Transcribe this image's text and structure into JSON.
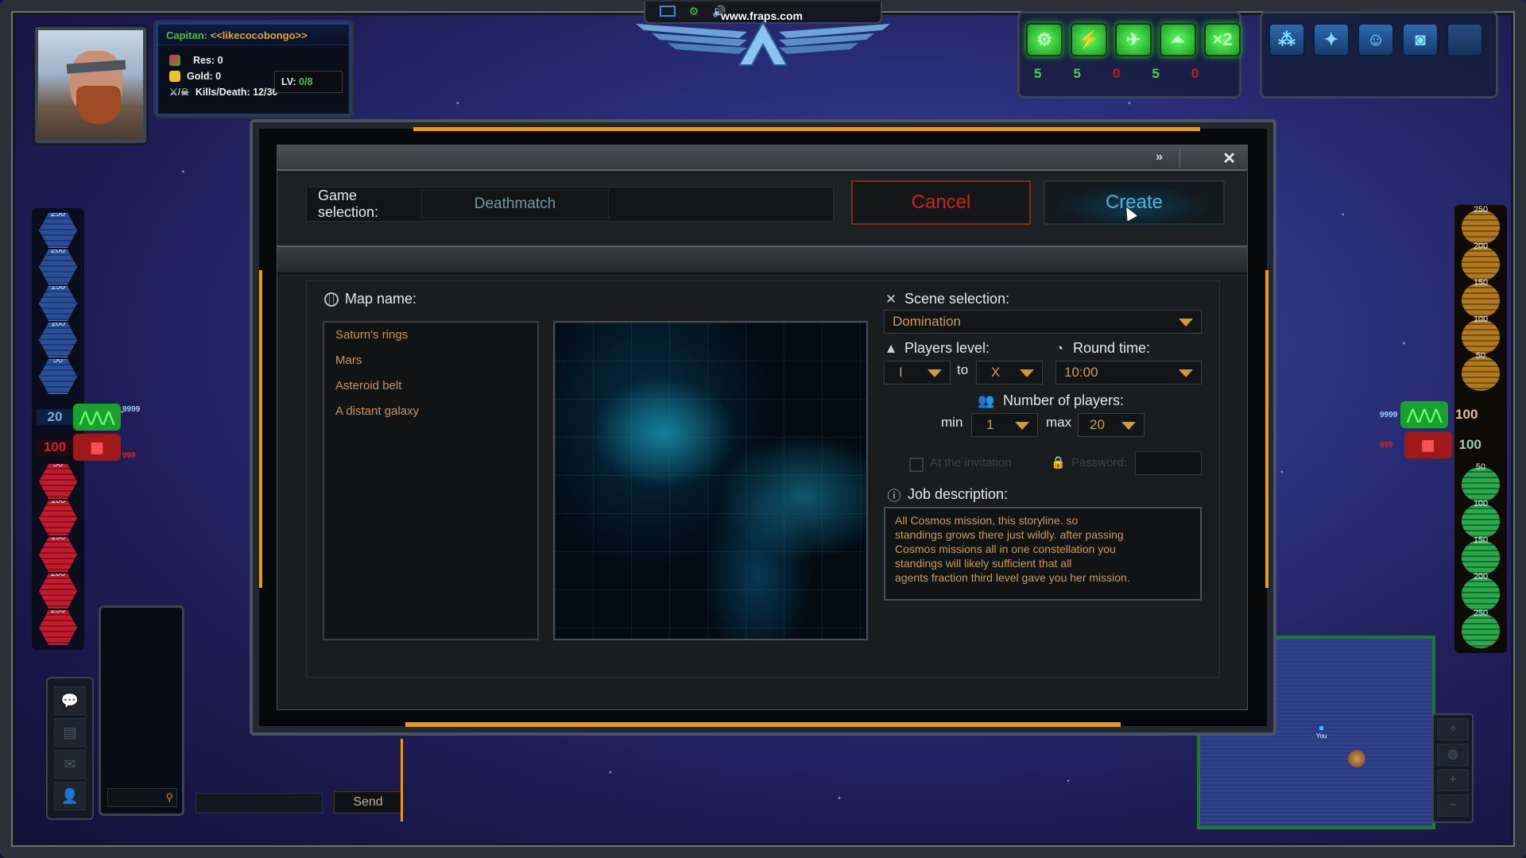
{
  "hud": {
    "player": {
      "title_prefix": "Capitan:",
      "name": "<<likecocobongo>>",
      "res_label": "Res: 0",
      "gold_label": "Gold: 0",
      "kd_label": "Kills/Death: 12/30",
      "lv_label": "LV:",
      "lv_value": "0/8"
    },
    "top_bar": {
      "watermark": "www.fraps.com",
      "icons": [
        "screen-icon",
        "gear-icon",
        "speaker-icon"
      ]
    },
    "ability_green": {
      "buttons": [
        {
          "icon": "shield-gear-icon",
          "glyph": "⚙",
          "count": "5",
          "count_color": "green"
        },
        {
          "icon": "shield-bolt-icon",
          "glyph": "⚡",
          "count": "5",
          "count_color": "green"
        },
        {
          "icon": "rocket-icon",
          "glyph": "✈",
          "count": "0",
          "count_color": "red"
        },
        {
          "icon": "rank-chevron-icon",
          "glyph": "⏶",
          "count": "5",
          "count_color": "green"
        },
        {
          "icon": "x2-icon",
          "glyph": "×2",
          "count": "0",
          "count_color": "red"
        }
      ]
    },
    "ability_blue": {
      "buttons": [
        {
          "icon": "formation-icon",
          "glyph": "⁂"
        },
        {
          "icon": "target-ship-icon",
          "glyph": "✦"
        },
        {
          "icon": "smiley-icon",
          "glyph": "☺"
        },
        {
          "icon": "goggles-icon",
          "glyph": "◙"
        },
        {
          "icon": "empty-slot",
          "glyph": ""
        }
      ]
    },
    "left_gauge": {
      "top_ticks": [
        "250",
        "200",
        "150",
        "100",
        "50"
      ],
      "bottom_ticks": [
        "50",
        "100",
        "150",
        "200",
        "250"
      ],
      "upper_value": "20",
      "lower_value": "100",
      "upper_small": "9999",
      "lower_small": "999"
    },
    "right_gauge": {
      "top_ticks": [
        "250",
        "200",
        "150",
        "100",
        "50"
      ],
      "bottom_ticks": [
        "50",
        "100",
        "150",
        "200",
        "250"
      ],
      "upper_value": "100",
      "lower_value": "100",
      "upper_small": "9999",
      "lower_small": "999"
    },
    "chat": {
      "send_label": "Send",
      "side_buttons": [
        "chat-bubbles-icon",
        "message-icon",
        "mail-icon",
        "user-icon"
      ]
    },
    "minimap": {
      "you_label": "You"
    }
  },
  "dialog": {
    "game_selection_label": "Game selection:",
    "game_selection_value": "Deathmatch",
    "cancel_label": "Cancel",
    "create_label": "Create",
    "map_name_label": "Map name:",
    "maps": [
      "Saturn's rings",
      "Mars",
      "Asteroid belt",
      "A distant galaxy"
    ],
    "scene_selection_label": "Scene selection:",
    "scene_selection_value": "Domination",
    "players_level_label": "Players level:",
    "level_from": "I",
    "level_to_label": "to",
    "level_to": "X",
    "round_time_label": "Round time:",
    "round_time_value": "10:00",
    "number_of_players_label": "Number of players:",
    "min_label": "min",
    "min_value": "1",
    "max_label": "max",
    "max_value": "20",
    "invitation_label": "At the invitation",
    "password_label": "Password:",
    "password_value": "",
    "job_description_label": "Job description:",
    "job_description_lines": [
      "All Cosmos mission, this storyline. so",
      "standings grows there just wildly. after passing",
      "Cosmos missions all in one constellation you",
      "standings will likely sufficient that all",
      "agents fraction third level gave you her mission."
    ]
  },
  "colors": {
    "accent_orange": "#e89a20",
    "cancel_red": "#d02020",
    "create_cyan": "#4fb4d4",
    "value_tan": "#d09a56",
    "hud_green": "#4fc04a"
  }
}
